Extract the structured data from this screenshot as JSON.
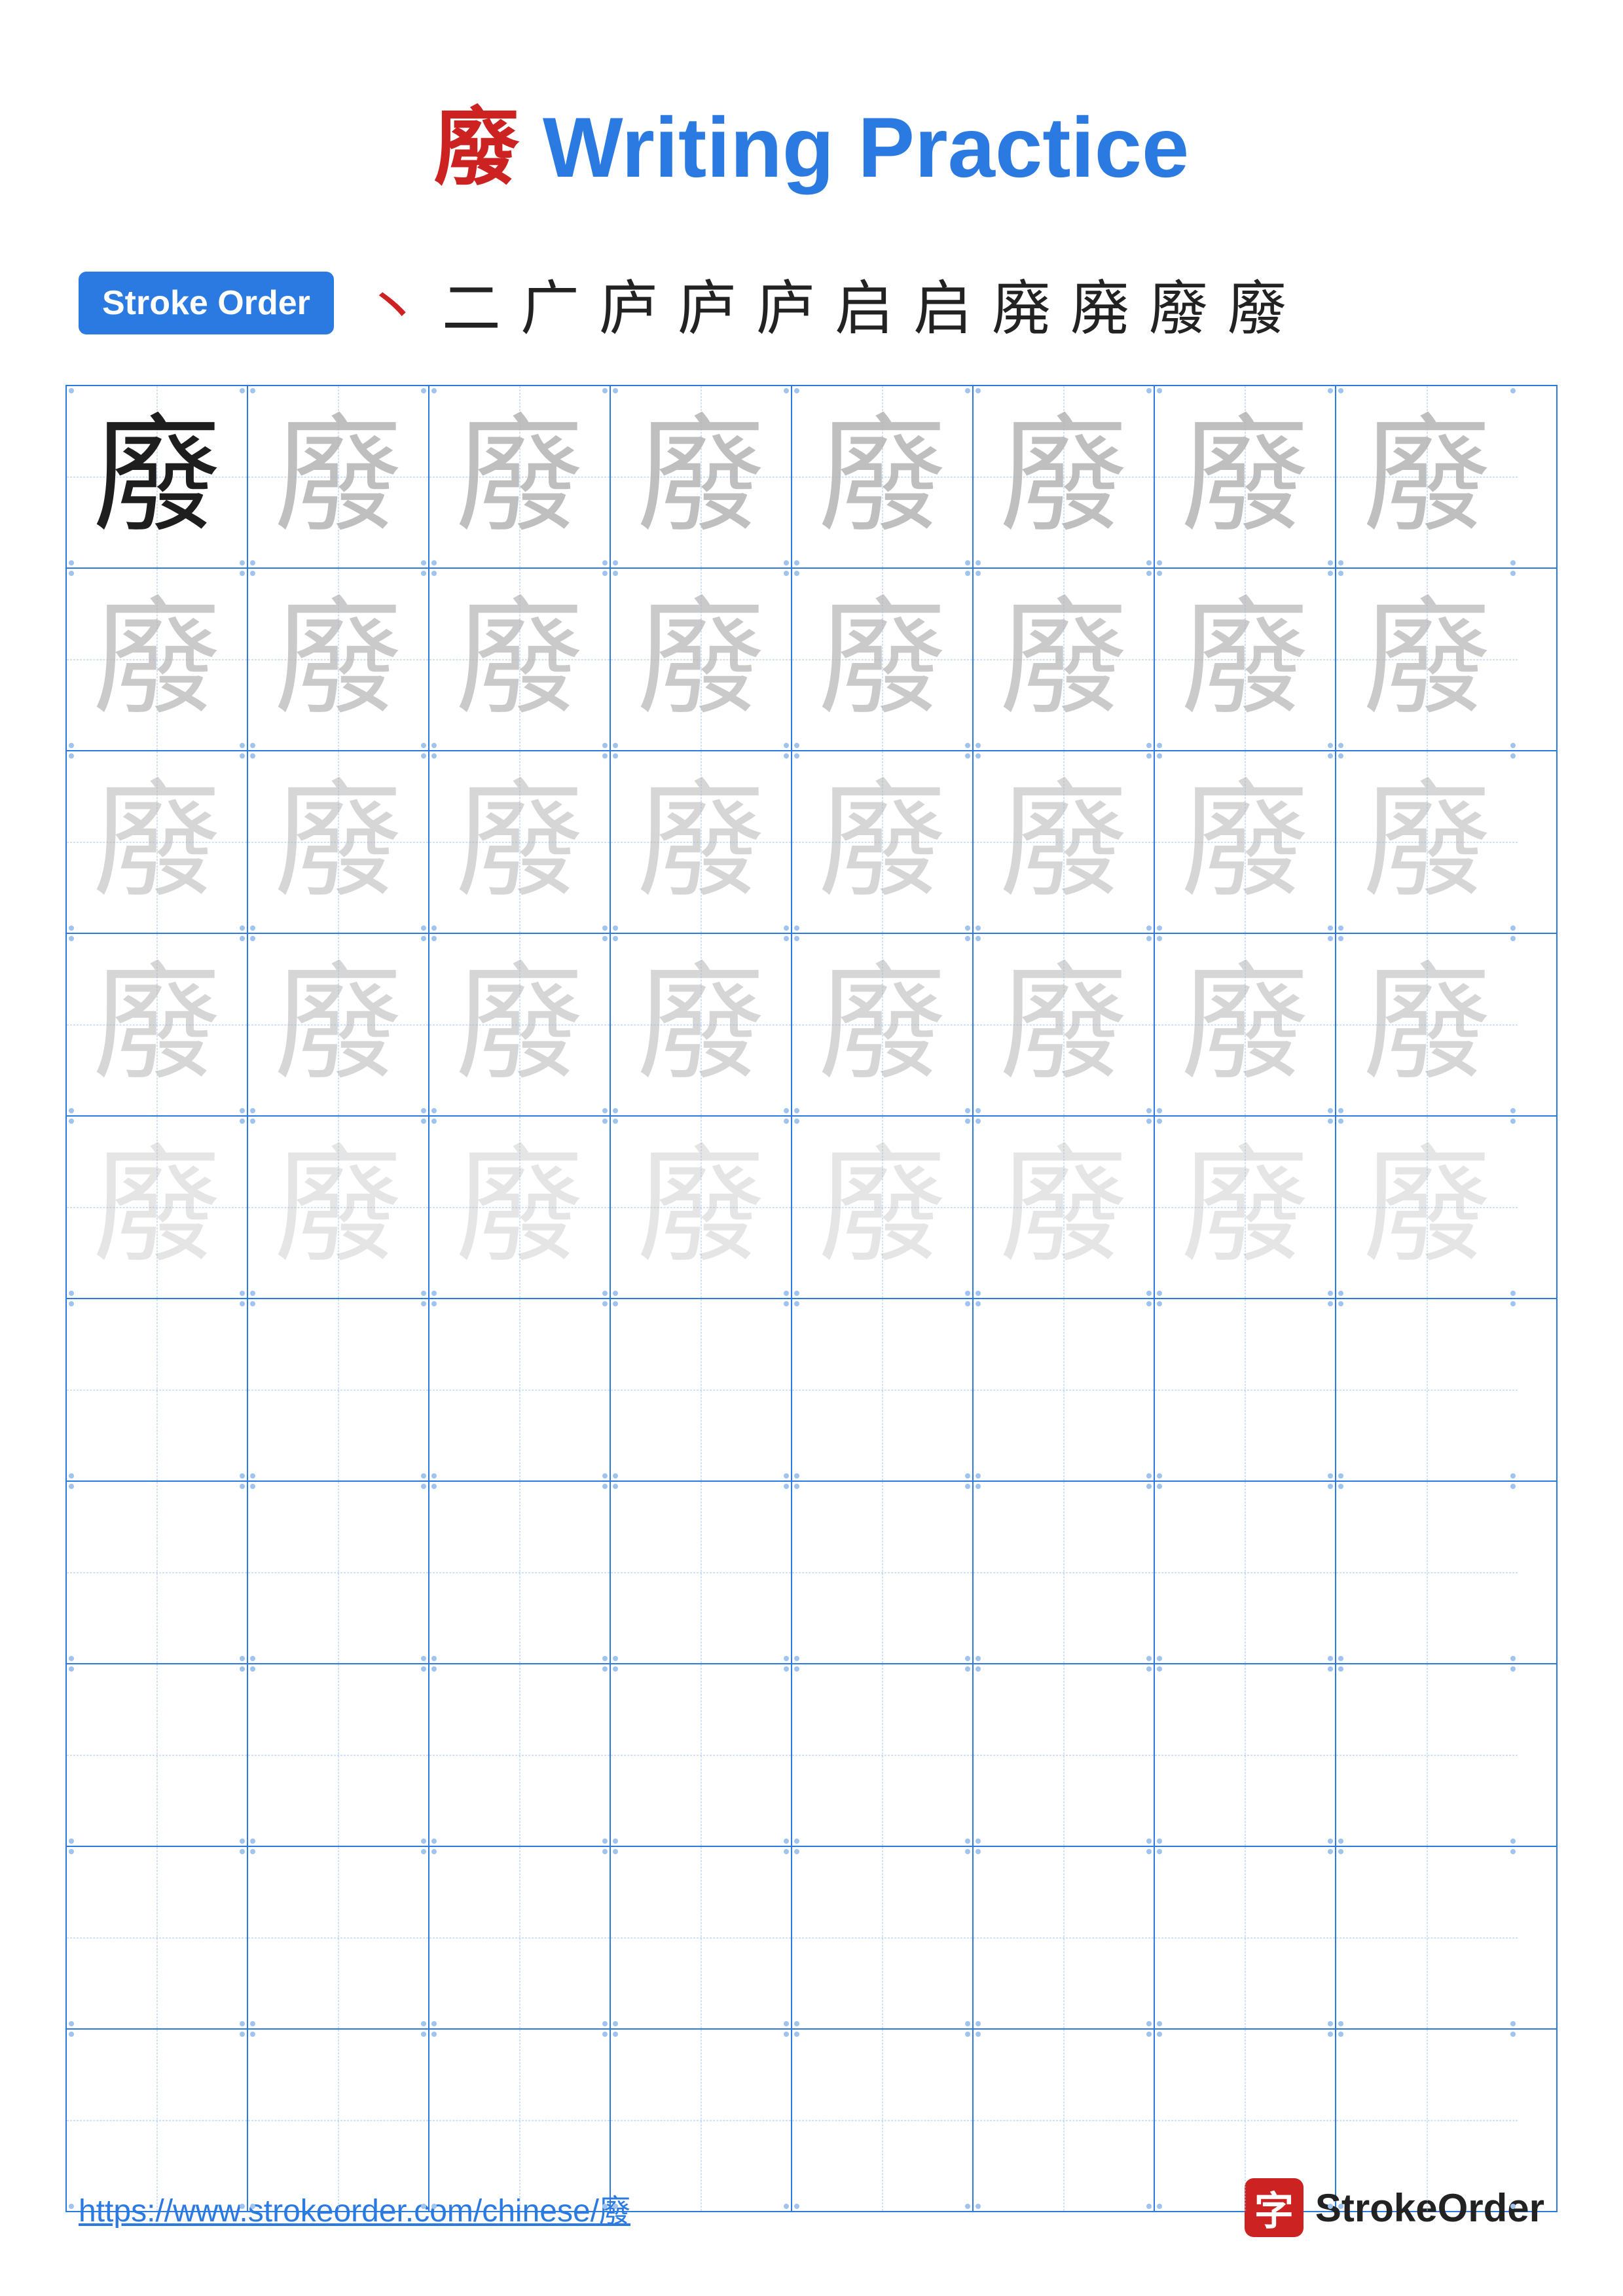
{
  "title": {
    "char": "廢",
    "suffix": " Writing Practice",
    "color": "#2a7ae2",
    "char_color": "#cc2222"
  },
  "stroke_order": {
    "badge_label": "Stroke Order",
    "strokes": [
      "丶",
      "二",
      "广",
      "庐",
      "庐",
      "庐",
      "启",
      "启",
      "廃",
      "廃",
      "廢",
      "廢"
    ]
  },
  "grid": {
    "char": "廢",
    "rows": 10,
    "cols": 8,
    "filled_rows": 5,
    "opacity_levels": [
      1,
      0.85,
      0.7,
      0.55,
      0.35
    ]
  },
  "footer": {
    "url": "https://www.strokeorder.com/chinese/廢",
    "logo_char": "字",
    "logo_text": "StrokeOrder"
  }
}
